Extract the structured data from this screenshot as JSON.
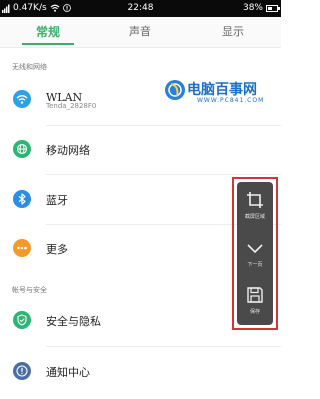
{
  "status_bar": {
    "speed": "0.47K/s",
    "time": "22:48",
    "battery": "38%"
  },
  "tabs": [
    {
      "label": "常规",
      "active": true
    },
    {
      "label": "声音",
      "active": false
    },
    {
      "label": "显示",
      "active": false
    }
  ],
  "sections": {
    "wireless": "无线和网络",
    "account": "帐号与安全"
  },
  "items": {
    "wlan": {
      "label": "WLAN",
      "sub": "Tenda_2828F0",
      "icon": "wifi-icon",
      "color": "#2aa3e6"
    },
    "mobile": {
      "label": "移动网络",
      "icon": "globe-icon",
      "color": "#2bb673"
    },
    "bluetooth": {
      "label": "蓝牙",
      "icon": "bluetooth-icon",
      "color": "#2b8ee6"
    },
    "more": {
      "label": "更多",
      "icon": "more-dots-icon",
      "color": "#f39a2b"
    },
    "security": {
      "label": "安全与隐私",
      "icon": "shield-icon",
      "color": "#2bb673"
    },
    "notify": {
      "label": "通知中心",
      "icon": "notification-icon",
      "color": "#4a6fa5"
    }
  },
  "watermark": {
    "name": "电脑百事网",
    "url": "WWW.PC841.COM"
  },
  "float_menu": {
    "crop": {
      "label": "截屏区域",
      "icon": "crop-icon"
    },
    "next": {
      "label": "下一页",
      "icon": "chevron-down-icon"
    },
    "save": {
      "label": "保存",
      "icon": "save-icon"
    }
  },
  "colors": {
    "accent": "#3fae6d",
    "panel_border": "#d3343c"
  }
}
